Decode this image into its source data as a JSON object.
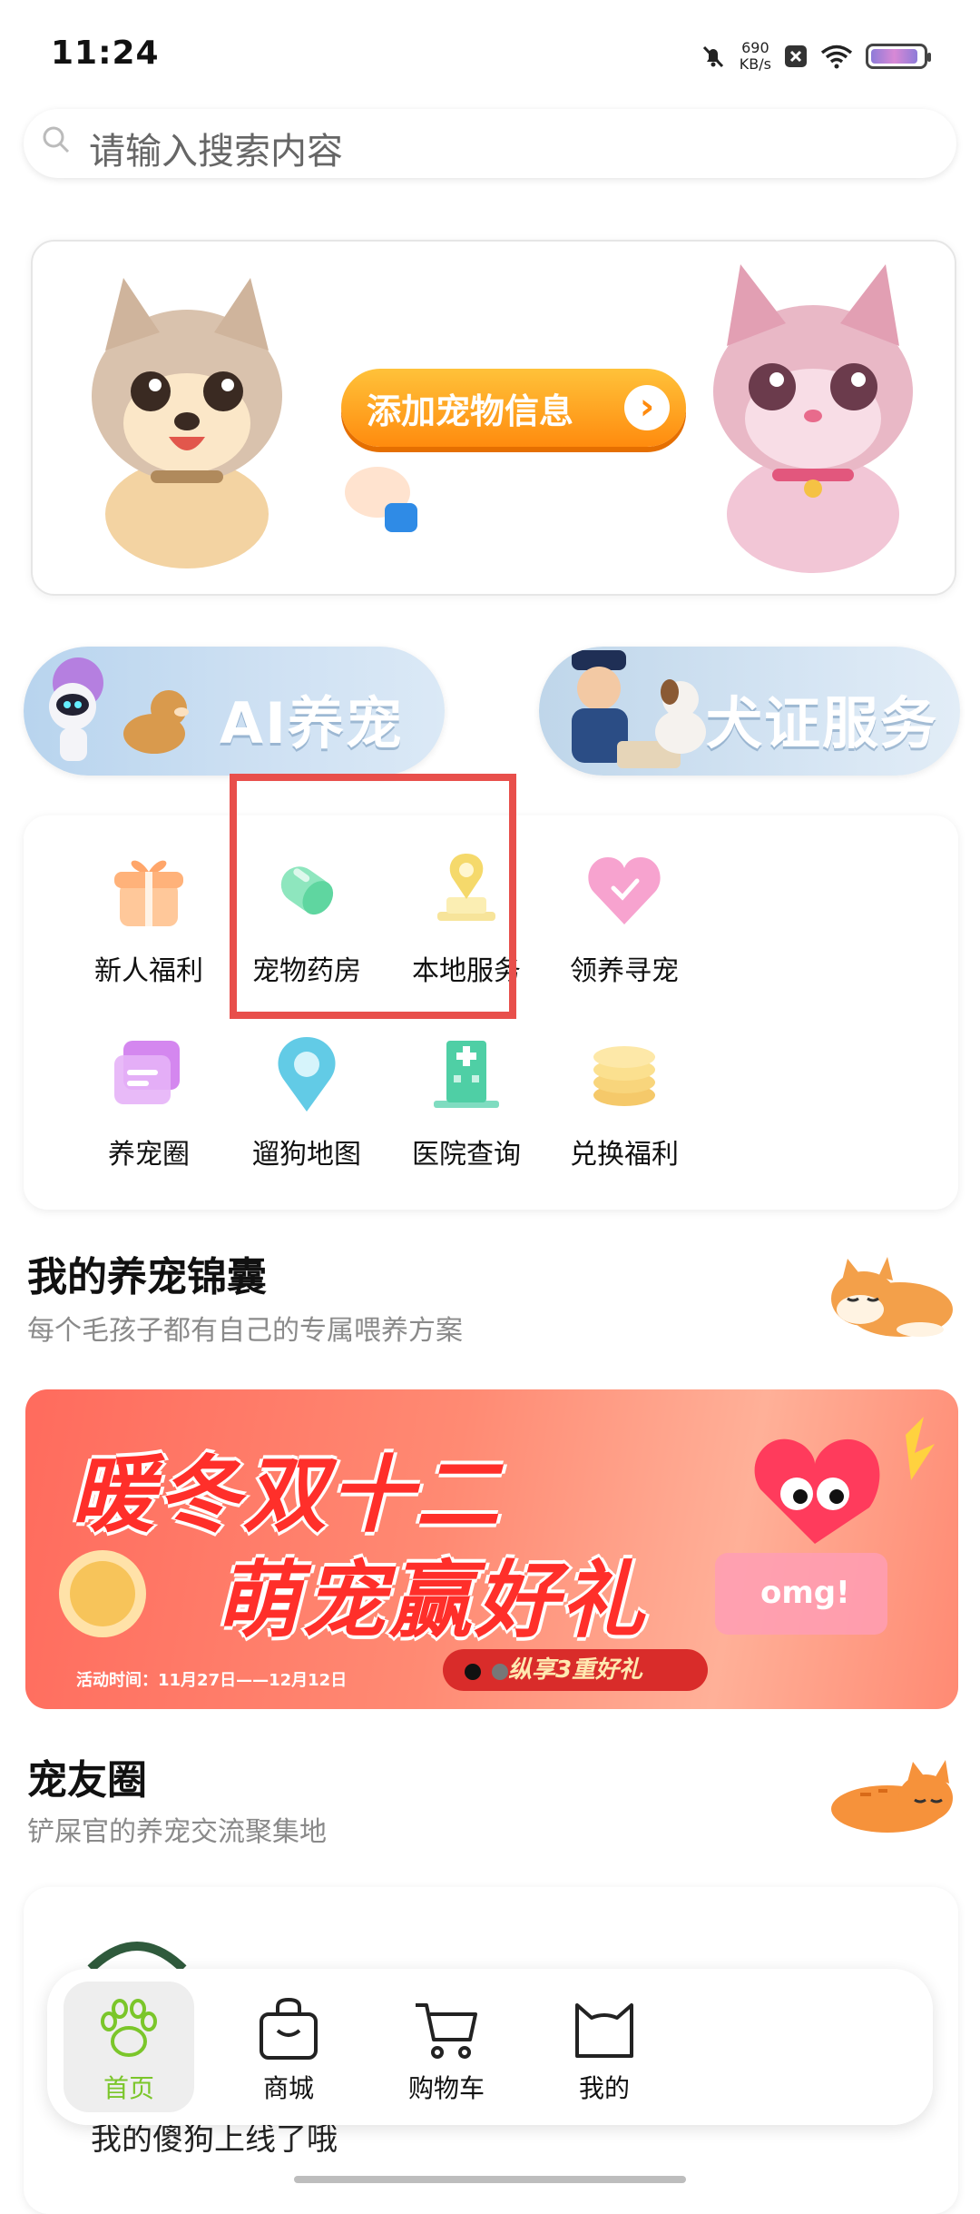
{
  "status_bar": {
    "time": "11:24",
    "net_speed_value": "690",
    "net_speed_unit": "KB/s"
  },
  "search": {
    "placeholder": "请输入搜索内容"
  },
  "banner": {
    "cta_label": "添加宠物信息"
  },
  "pills": {
    "ai_label": "AI养宠",
    "license_label": "犬证服务"
  },
  "grid": {
    "items": [
      {
        "label": "新人福利",
        "icon": "gift-icon"
      },
      {
        "label": "宠物药房",
        "icon": "capsule-icon"
      },
      {
        "label": "本地服务",
        "icon": "location-pin-icon"
      },
      {
        "label": "领养寻宠",
        "icon": "heart-icon"
      },
      {
        "label": "养宠圈",
        "icon": "chat-bubble-icon"
      },
      {
        "label": "遛狗地图",
        "icon": "map-pin-icon"
      },
      {
        "label": "医院查询",
        "icon": "hospital-icon"
      },
      {
        "label": "兑换福利",
        "icon": "coins-icon"
      }
    ]
  },
  "section_tips": {
    "title": "我的养宠锦囊",
    "subtitle": "每个毛孩子都有自己的专属喂养方案"
  },
  "promo": {
    "line1": "暖冬双十二",
    "line2": "萌宠赢好礼",
    "date": "活动时间：11月27日——12月12日",
    "tag": "纵享3重好礼"
  },
  "section_circle": {
    "title": "宠友圈",
    "subtitle": "铲屎官的养宠交流聚集地"
  },
  "post": {
    "text": "我的傻狗上线了哦"
  },
  "bottom_nav": {
    "items": [
      {
        "label": "首页",
        "icon": "paw-icon"
      },
      {
        "label": "商城",
        "icon": "shopping-bag-icon"
      },
      {
        "label": "购物车",
        "icon": "cart-icon"
      },
      {
        "label": "我的",
        "icon": "cat-face-icon"
      }
    ]
  },
  "colors": {
    "accent_green": "#7bc62a",
    "highlight_red": "#e84f4b",
    "cta_orange": "#ff8b0e"
  }
}
